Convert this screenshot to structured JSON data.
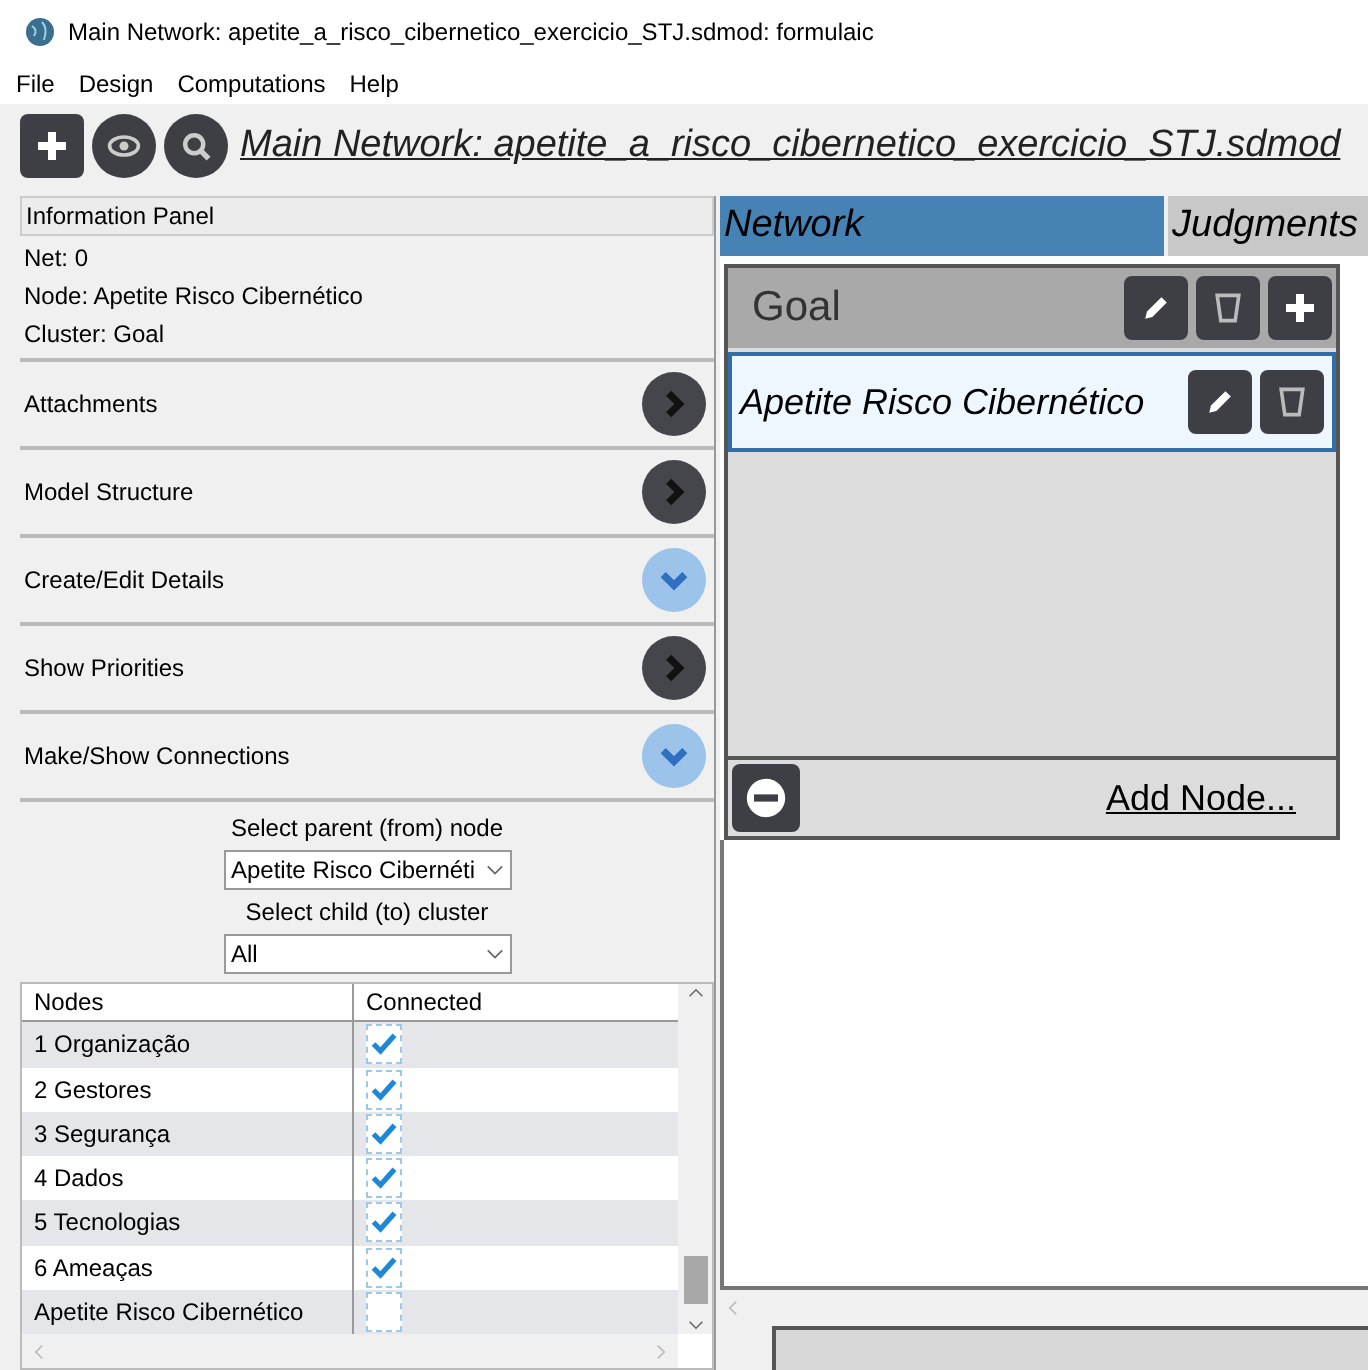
{
  "window": {
    "title": "Main Network: apetite_a_risco_cibernetico_exercicio_STJ.sdmod: formulaic"
  },
  "menu": [
    "File",
    "Design",
    "Computations",
    "Help"
  ],
  "toolbar": {
    "title": "Main Network: apetite_a_risco_cibernetico_exercicio_STJ.sdmod"
  },
  "info_panel": {
    "header": "Information Panel",
    "lines": [
      "Net: 0",
      "Node: Apetite Risco Cibernético",
      "Cluster: Goal"
    ]
  },
  "sections": [
    {
      "label": "Attachments",
      "expanded": false
    },
    {
      "label": "Model Structure",
      "expanded": false
    },
    {
      "label": "Create/Edit Details",
      "expanded": true
    },
    {
      "label": "Show Priorities",
      "expanded": false
    },
    {
      "label": "Make/Show Connections",
      "expanded": true
    }
  ],
  "connections": {
    "parent_label": "Select parent (from) node",
    "parent_value": "Apetite Risco Cibernéti",
    "child_label": "Select child (to) cluster",
    "child_value": "All",
    "columns": [
      "Nodes",
      "Connected"
    ],
    "rows": [
      {
        "name": "1 Organização",
        "checked": true
      },
      {
        "name": "2 Gestores",
        "checked": true
      },
      {
        "name": "3 Segurança",
        "checked": true
      },
      {
        "name": "4 Dados",
        "checked": true
      },
      {
        "name": "5 Tecnologias",
        "checked": true
      },
      {
        "name": "6 Ameaças",
        "checked": true
      },
      {
        "name": "Apetite Risco Cibernético",
        "checked": false
      }
    ]
  },
  "tabs": [
    {
      "label": "Network",
      "selected": true
    },
    {
      "label": "Judgments",
      "selected": false
    }
  ],
  "cluster": {
    "name": "Goal",
    "nodes": [
      {
        "name": "Apetite Risco Cibernético",
        "selected": true
      }
    ],
    "add_link": "Add Node..."
  }
}
